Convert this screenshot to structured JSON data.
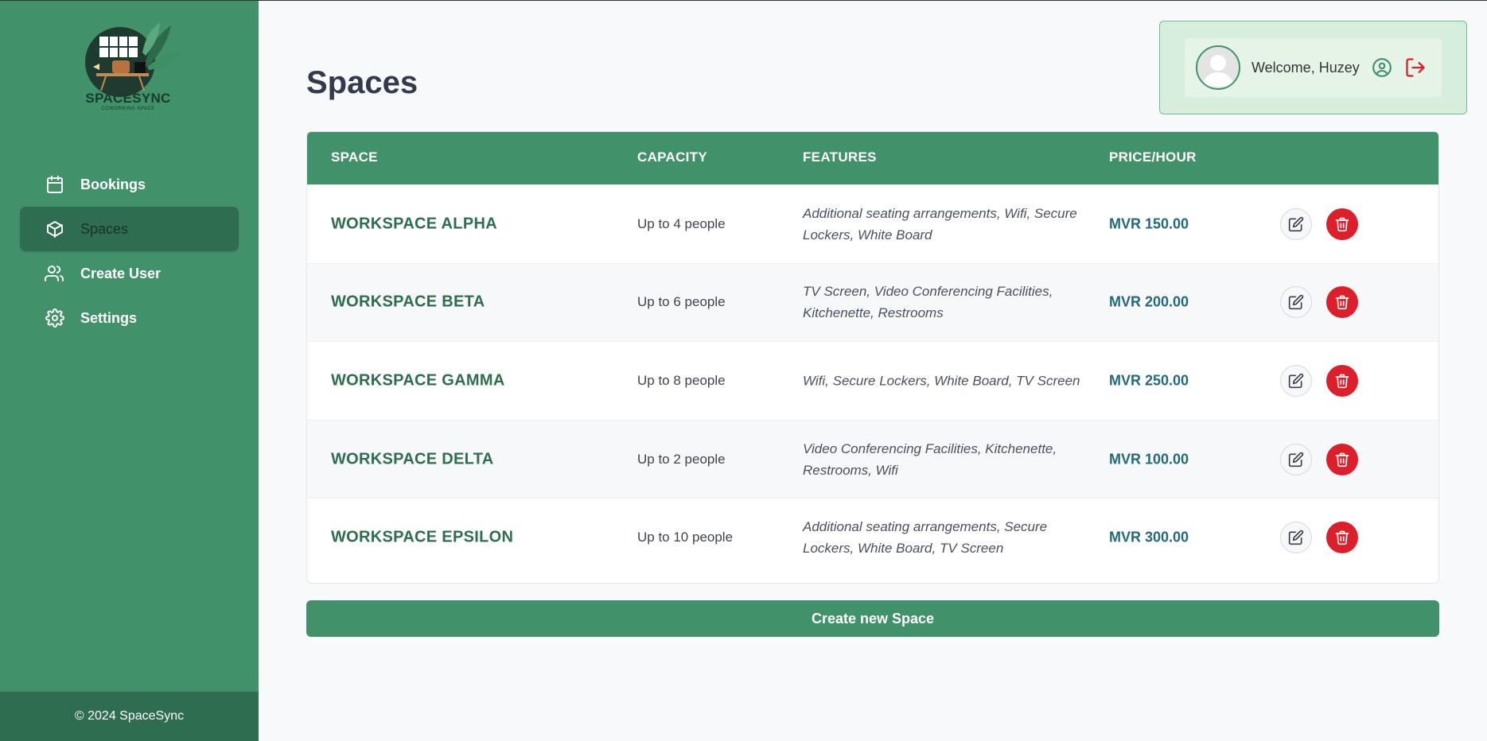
{
  "brand": {
    "name": "SPACESYNC",
    "tagline": "COWORKING SPACE"
  },
  "sidebar": {
    "items": [
      {
        "label": "Bookings",
        "icon": "calendar-icon"
      },
      {
        "label": "Spaces",
        "icon": "cube-icon",
        "active": true
      },
      {
        "label": "Create User",
        "icon": "users-icon"
      },
      {
        "label": "Settings",
        "icon": "gear-icon"
      }
    ],
    "footer": "© 2024 SpaceSync"
  },
  "header": {
    "title": "Spaces",
    "welcome": "Welcome, Huzey"
  },
  "table": {
    "columns": [
      "SPACE",
      "CAPACITY",
      "FEATURES",
      "PRICE/HOUR"
    ],
    "rows": [
      {
        "space": "WORKSPACE ALPHA",
        "capacity": "Up to 4 people",
        "features": "Additional seating arrangements, Wifi, Secure Lockers, White Board",
        "price": "MVR 150.00"
      },
      {
        "space": "WORKSPACE BETA",
        "capacity": "Up to 6 people",
        "features": "TV Screen, Video Conferencing Facilities, Kitchenette, Restrooms",
        "price": "MVR 200.00"
      },
      {
        "space": "WORKSPACE GAMMA",
        "capacity": "Up to 8 people",
        "features": "Wifi, Secure Lockers, White Board, TV Screen",
        "price": "MVR 250.00"
      },
      {
        "space": "WORKSPACE DELTA",
        "capacity": "Up to 2 people",
        "features": "Video Conferencing Facilities, Kitchenette, Restrooms, Wifi",
        "price": "MVR 100.00"
      },
      {
        "space": "WORKSPACE EPSILON",
        "capacity": "Up to 10 people",
        "features": "Additional seating arrangements, Secure Lockers, White Board, TV Screen",
        "price": "MVR 300.00"
      }
    ]
  },
  "actions": {
    "create_label": "Create new Space"
  },
  "colors": {
    "primary": "#41916b",
    "primary_dark": "#2f6d51",
    "danger": "#dc1f2a",
    "price": "#226a78"
  }
}
